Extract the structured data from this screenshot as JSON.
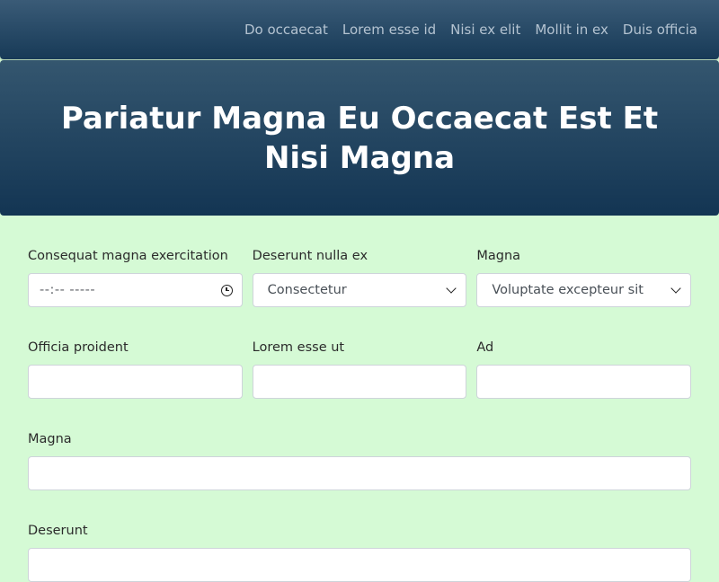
{
  "nav": {
    "links": [
      "Do occaecat",
      "Lorem esse id",
      "Nisi ex elit",
      "Mollit in ex",
      "Duis officia"
    ]
  },
  "hero": {
    "title": "Pariatur Magna Eu Occaecat Est Et Nisi Magna"
  },
  "form": {
    "row1": {
      "time": {
        "label": "Consequat magna exercitation",
        "placeholder": "--:-- -----"
      },
      "select1": {
        "label": "Deserunt nulla ex",
        "value": "Consectetur"
      },
      "select2": {
        "label": "Magna",
        "value": "Voluptate excepteur sit"
      }
    },
    "row2": {
      "field1": {
        "label": "Officia proident",
        "value": ""
      },
      "field2": {
        "label": "Lorem esse ut",
        "value": ""
      },
      "field3": {
        "label": "Ad",
        "value": ""
      }
    },
    "magna": {
      "label": "Magna",
      "value": ""
    },
    "deserunt": {
      "label": "Deserunt",
      "value": ""
    }
  },
  "colors": {
    "page_bg": "#d5fad5",
    "header_bg": "#1f4361",
    "nav_text": "#b4c3d1"
  },
  "icons": [
    "clock-icon",
    "chevron-down-icon"
  ]
}
